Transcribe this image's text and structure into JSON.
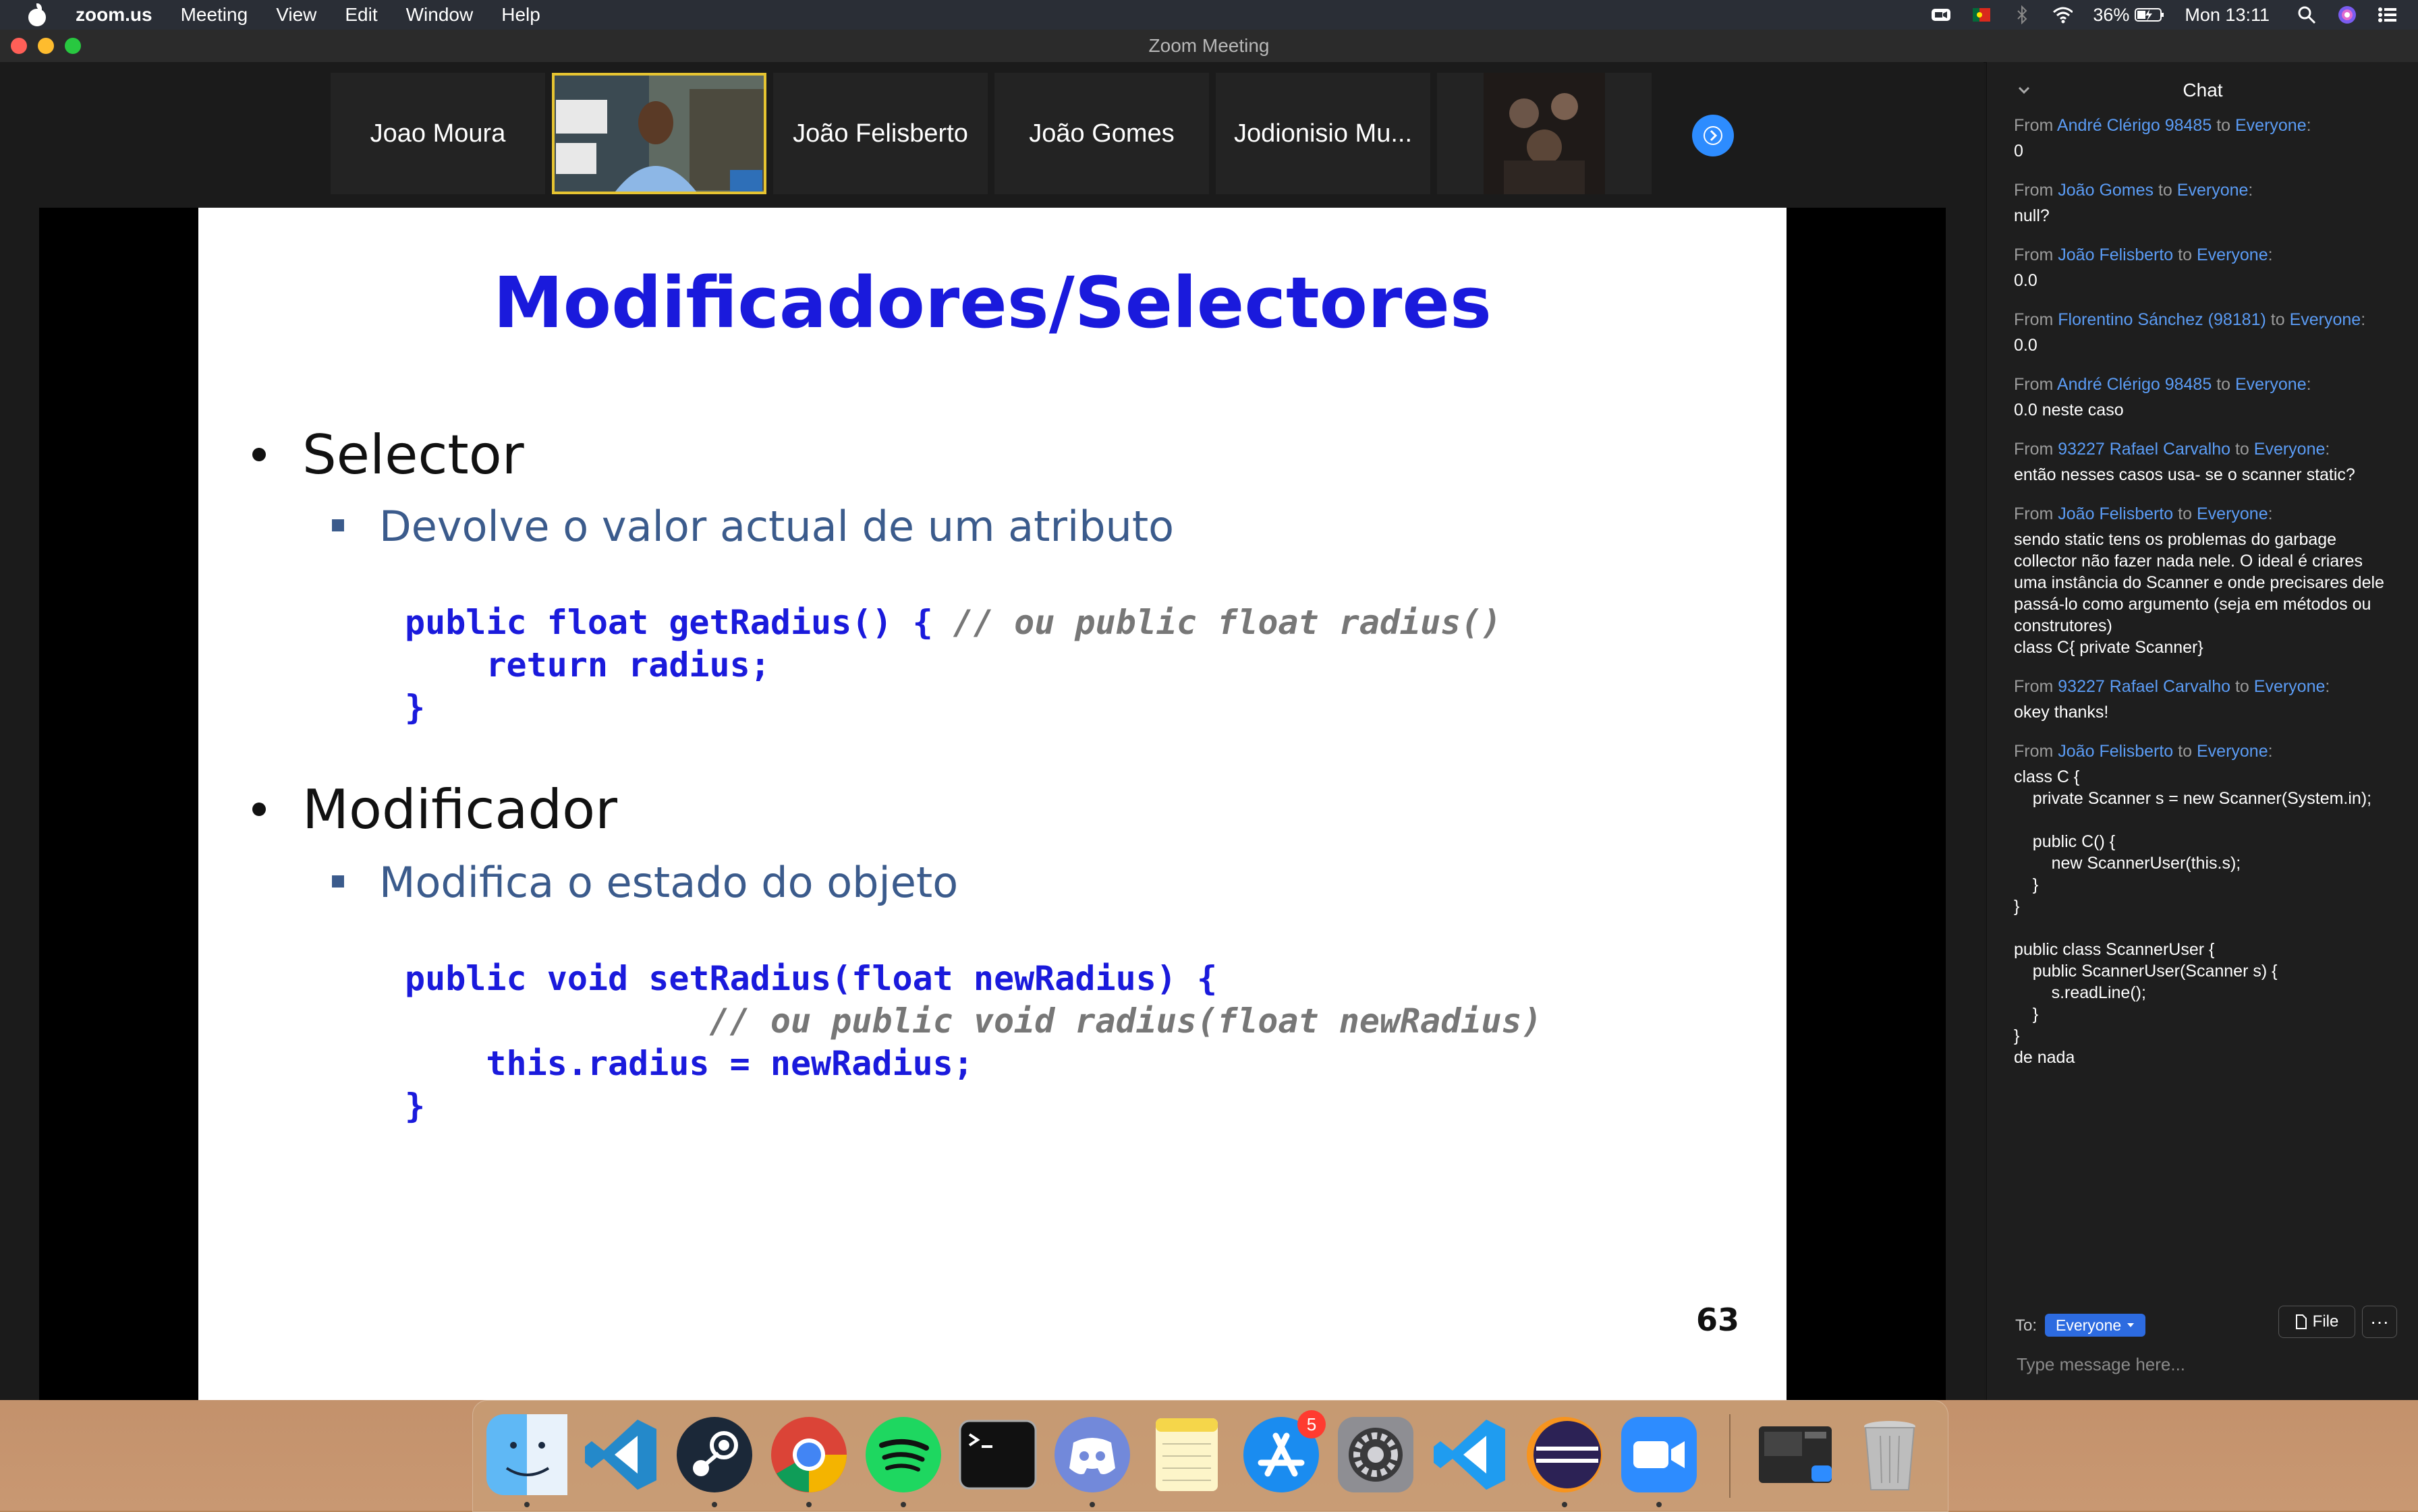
{
  "menubar": {
    "app_name": "zoom.us",
    "items": [
      "Meeting",
      "View",
      "Edit",
      "Window",
      "Help"
    ],
    "battery": "36%",
    "clock": "Mon 13:11"
  },
  "window": {
    "title": "Zoom Meeting"
  },
  "gallery": {
    "tiles": [
      "Joao Moura",
      "João Felisberto",
      "João Gomes",
      "Jodionisio Mu..."
    ]
  },
  "slide": {
    "title": "Modificadores/Selectores",
    "bullet1": "Selector",
    "sub1": "Devolve o valor actual de um atributo",
    "code1_line1": "public float getRadius() { ",
    "code1_line1_comment": "// ou public float radius()",
    "code1_line2": "    return radius;",
    "code1_line3": "}",
    "bullet2": "Modificador",
    "sub2": "Modifica o estado do objeto",
    "code2_line1": "public void setRadius(float newRadius) {",
    "code2_line2_comment": "               // ou public void radius(float newRadius)",
    "code2_line3": "    this.radius = newRadius;",
    "code2_line4": "}",
    "page_number": "63"
  },
  "chat": {
    "title": "Chat",
    "messages": [
      {
        "from": "André Clérigo 98485",
        "to": "Everyone",
        "text": "0"
      },
      {
        "from": "João Gomes",
        "to": "Everyone",
        "text": "null?"
      },
      {
        "from": "João Felisberto",
        "to": "Everyone",
        "text": "0.0"
      },
      {
        "from": "Florentino Sánchez (98181)",
        "to": "Everyone",
        "text": "0.0"
      },
      {
        "from": "André Clérigo 98485",
        "to": "Everyone",
        "text": "0.0 neste caso"
      },
      {
        "from": "93227 Rafael Carvalho",
        "to": "Everyone",
        "text": "então nesses casos usa- se o scanner static?"
      },
      {
        "from": "João Felisberto",
        "to": "Everyone",
        "text": "sendo static tens os problemas do garbage collector não fazer nada nele. O ideal é criares uma instância do Scanner e onde precisares dele passá-lo como argumento (seja em métodos ou construtores)\nclass C{ private Scanner}"
      },
      {
        "from": "93227 Rafael Carvalho",
        "to": "Everyone",
        "text": "okey thanks!"
      },
      {
        "from": "João Felisberto",
        "to": "Everyone",
        "text": "class C {\n    private Scanner s = new Scanner(System.in);\n\n    public C() {\n        new ScannerUser(this.s);\n    }\n}\n\npublic class ScannerUser {\n    public ScannerUser(Scanner s) {\n        s.readLine();\n    }\n}\nde nada"
      }
    ],
    "from_word": "From",
    "to_word": "to",
    "to_label": "To:",
    "recipient": "Everyone",
    "file_label": "File",
    "more_label": "···",
    "input_placeholder": "Type message here..."
  },
  "dock": {
    "apps": [
      "finder-icon",
      "vscode-icon",
      "steam-icon",
      "chrome-icon",
      "spotify-icon",
      "terminal-icon",
      "discord-icon",
      "notes-icon",
      "app-store-icon",
      "system-preferences-icon",
      "vscode-insiders-icon",
      "eclipse-icon",
      "zoom-icon"
    ],
    "app_store_badge": "5"
  },
  "colors": {
    "slide_title": "#1a1adc",
    "slide_sub": "#3b5b8c",
    "chat_name": "#5b9cf5",
    "zoom_blue": "#2d8cff",
    "active_speaker": "#e6c431"
  }
}
